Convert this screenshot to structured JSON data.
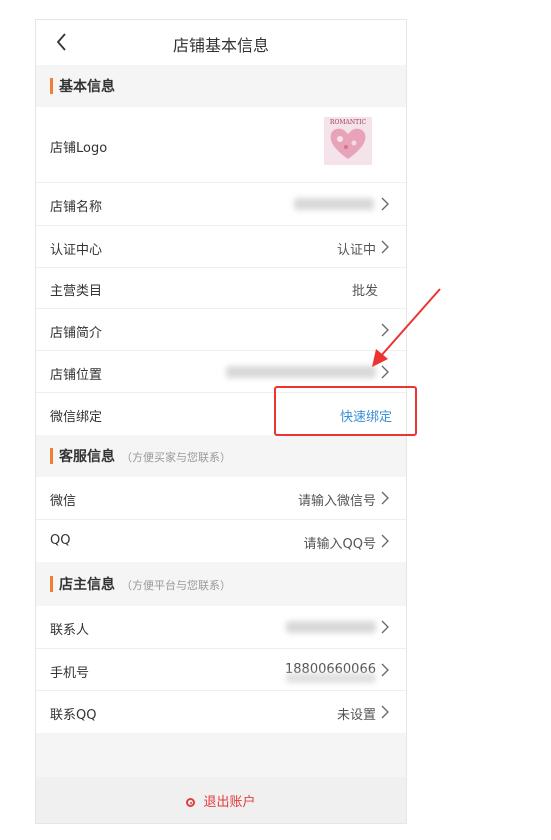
{
  "nav": {
    "title": "店铺基本信息"
  },
  "basic": {
    "title": "基本信息",
    "logo_label": "店铺Logo",
    "logo_text": "ROMANTIC",
    "name_label": "店铺名称",
    "cert_label": "认证中心",
    "cert_value": "认证中",
    "category_label": "主营类目",
    "category_value": "批发",
    "intro_label": "店铺简介",
    "location_label": "店铺位置",
    "wechat_bind_label": "微信绑定",
    "wechat_bind_value": "快速绑定"
  },
  "service": {
    "title": "客服信息",
    "hint": "（方便买家与您联系）",
    "wechat_label": "微信",
    "wechat_placeholder": "请输入微信号",
    "qq_label": "QQ",
    "qq_placeholder": "请输入QQ号"
  },
  "owner": {
    "title": "店主信息",
    "hint": "（方便平台与您联系）",
    "contact_label": "联系人",
    "phone_label": "手机号",
    "phone_value": "18800660066",
    "contact_qq_label": "联系QQ",
    "contact_qq_value": "未设置"
  },
  "footer": {
    "logout": "退出账户"
  },
  "colors": {
    "accent": "#f07e34",
    "link": "#3d8fd6",
    "danger": "#e33"
  }
}
